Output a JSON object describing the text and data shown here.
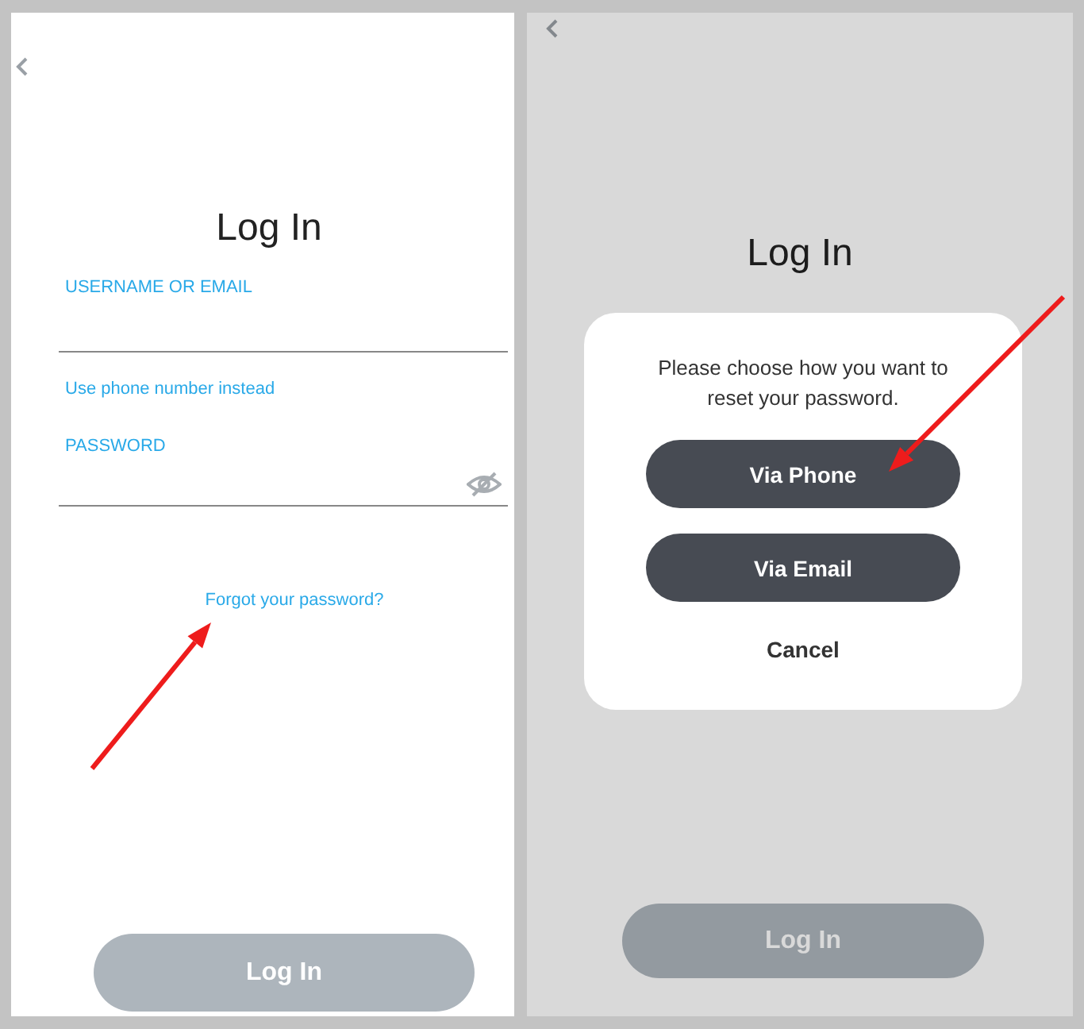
{
  "screens": [
    {
      "dimmed": false,
      "pointer_arrow": true,
      "title": "Log In",
      "username_label": "USERNAME OR EMAIL",
      "phone_link": "Use phone number instead",
      "password_label": "PASSWORD",
      "forgot_link": "Forgot your password?",
      "login_button": "Log In"
    },
    {
      "dimmed": true,
      "pointer_arrow": true,
      "title": "Log In",
      "login_button": "Log In",
      "dialog": {
        "message": "Please choose how you want to reset your password.",
        "options": [
          "Via Phone",
          "Via Email"
        ],
        "cancel": "Cancel"
      }
    }
  ]
}
